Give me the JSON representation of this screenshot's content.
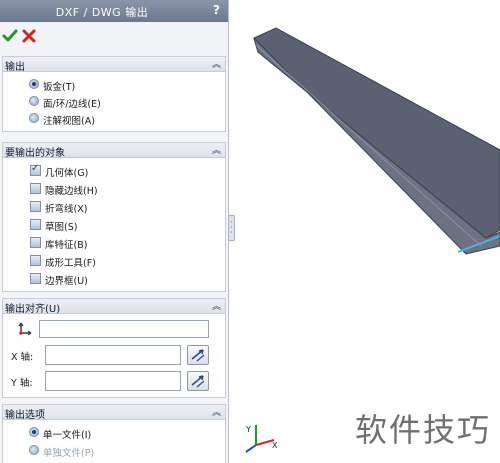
{
  "window": {
    "title": "DXF / DWG 输出",
    "help": "?"
  },
  "toolbar": {
    "ok_icon": "checkmark-icon",
    "cancel_icon": "x-icon"
  },
  "output_group": {
    "title": "输出",
    "options": [
      {
        "label": "钣金(T)",
        "selected": true
      },
      {
        "label": "面/环/边线(E)",
        "selected": false
      },
      {
        "label": "注解视图(A)",
        "selected": false
      }
    ]
  },
  "export_objects_group": {
    "title": "要输出的对象",
    "items": [
      {
        "label": "几何体(G)",
        "checked": true
      },
      {
        "label": "隐藏边线(H)",
        "checked": false
      },
      {
        "label": "折弯线(X)",
        "checked": false
      },
      {
        "label": "草图(S)",
        "checked": false
      },
      {
        "label": "库特征(B)",
        "checked": false
      },
      {
        "label": "成形工具(F)",
        "checked": false
      },
      {
        "label": "边界框(U)",
        "checked": false
      }
    ]
  },
  "alignment_group": {
    "title": "输出对齐(U)",
    "x_label": "X 轴:",
    "y_label": "Y 轴:",
    "origin_value": "",
    "x_value": "",
    "y_value": ""
  },
  "options_group": {
    "title": "输出选项",
    "options": [
      {
        "label": "单一文件(I)",
        "selected": true
      },
      {
        "label": "单独文件(P)",
        "selected": false
      }
    ]
  },
  "watermark": "软件技巧",
  "colors": {
    "panel_bg": "#f3f4f7",
    "title_bg": "#7a869c",
    "accent": "#2a4a86",
    "part_face": "#5b6170"
  }
}
